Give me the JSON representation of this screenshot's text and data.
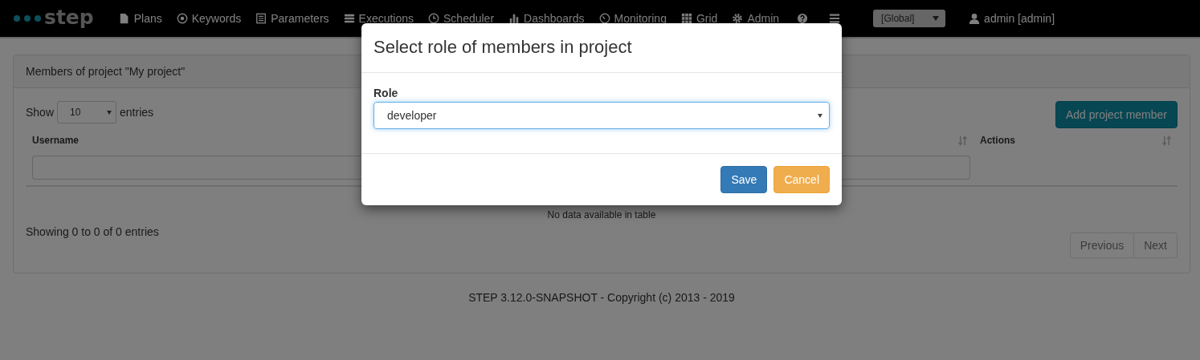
{
  "navbar": {
    "logo": "step",
    "items": [
      {
        "kind": "link",
        "label": "Plans"
      },
      {
        "kind": "link",
        "label": "Keywords"
      },
      {
        "kind": "link",
        "label": "Parameters"
      },
      {
        "kind": "link",
        "label": "Executions"
      },
      {
        "kind": "link",
        "label": "Scheduler"
      },
      {
        "kind": "link",
        "label": "Dashboards"
      },
      {
        "kind": "link",
        "label": "Monitoring"
      },
      {
        "kind": "link",
        "label": "Grid"
      },
      {
        "kind": "link",
        "label": "Admin"
      },
      {
        "kind": "icon"
      },
      {
        "kind": "icon"
      }
    ],
    "context_select": {
      "value": "[Global]"
    },
    "user": "admin [admin]"
  },
  "panel": {
    "title": "Members of project \"My project\"",
    "length": {
      "prefix": "Show",
      "value": "10",
      "suffix": "entries"
    },
    "add_button": "Add project member",
    "table": {
      "columns": [
        {
          "label": "Username"
        },
        {},
        {
          "label": "Actions"
        }
      ],
      "empty_message": "No data available in table"
    },
    "info": "Showing 0 to 0 of 0 entries",
    "pagination": [
      {
        "label": "Previous",
        "disabled": true
      },
      {
        "label": "Next",
        "disabled": true
      }
    ]
  },
  "footer": "STEP 3.12.0-SNAPSHOT - Copyright (c) 2013 - 2019",
  "modal": {
    "title": "Select role of members in project",
    "field_label": "Role",
    "role_select": {
      "value": "developer",
      "focused": true
    },
    "buttons": [
      {
        "label": "Save",
        "kind": "primary"
      },
      {
        "label": "Cancel",
        "kind": "warning"
      }
    ]
  }
}
